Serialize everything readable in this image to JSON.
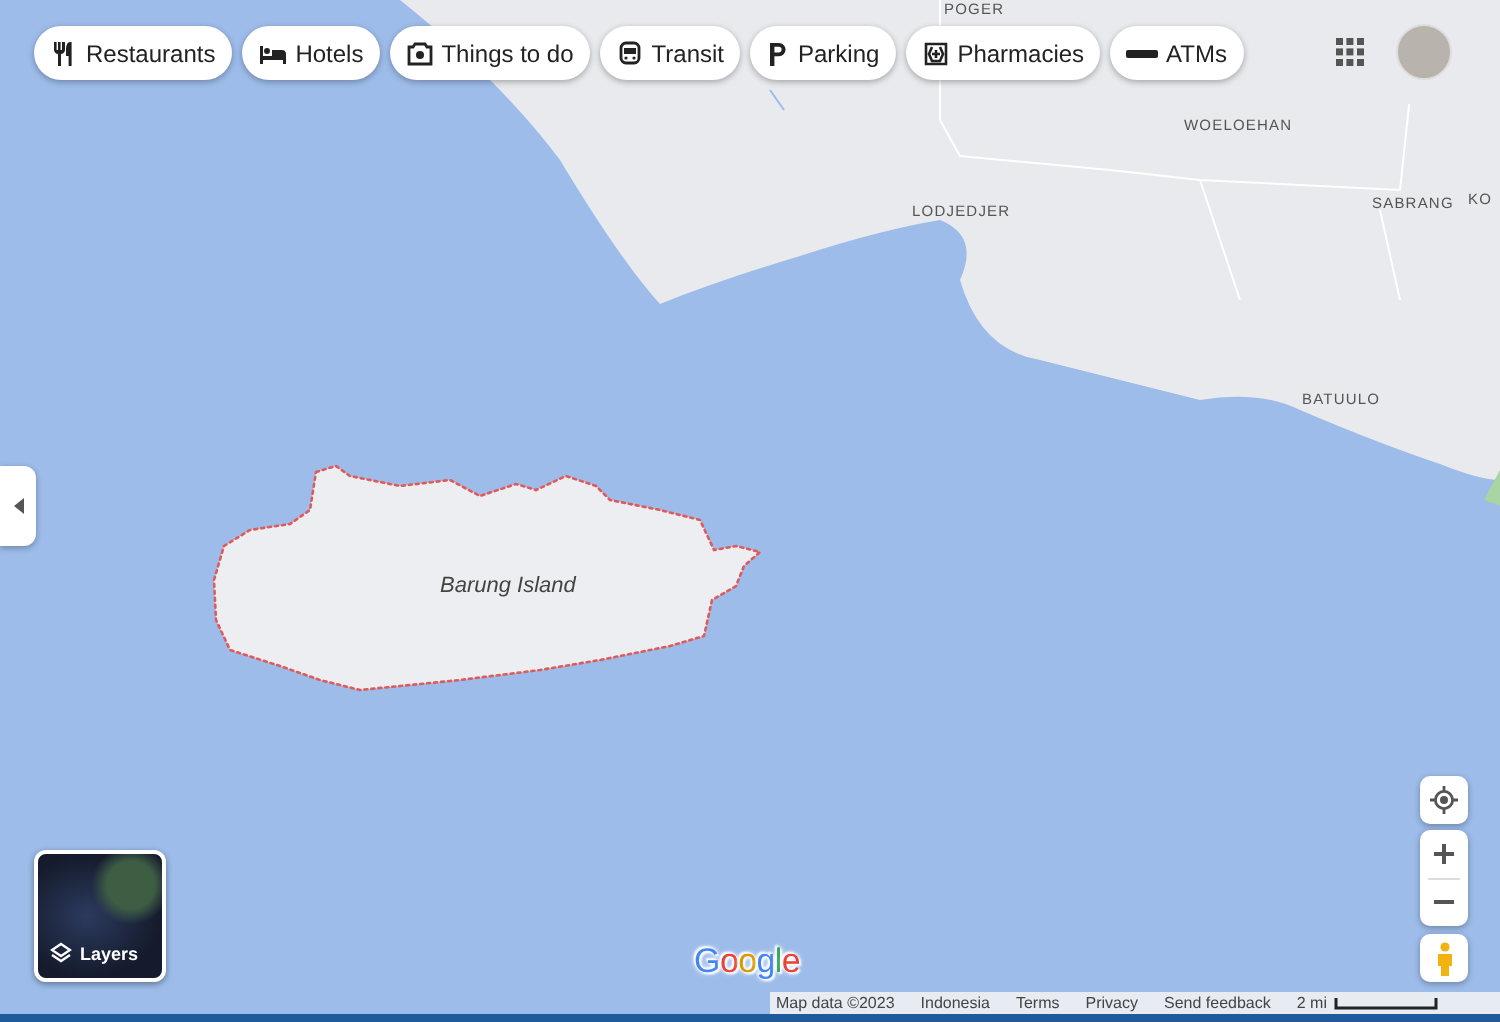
{
  "chips": [
    {
      "label": "Restaurants"
    },
    {
      "label": "Hotels"
    },
    {
      "label": "Things to do"
    },
    {
      "label": "Transit"
    },
    {
      "label": "Parking"
    },
    {
      "label": "Pharmacies"
    },
    {
      "label": "ATMs"
    }
  ],
  "map_labels": [
    {
      "text": "POGER",
      "kind": "village"
    },
    {
      "text": "WOELOEHAN",
      "kind": "village"
    },
    {
      "text": "LODJEDJER",
      "kind": "village"
    },
    {
      "text": "SABRANG",
      "kind": "village"
    },
    {
      "text": "KO",
      "kind": "village"
    },
    {
      "text": "BATUULO",
      "kind": "village"
    },
    {
      "text": "Barung Island",
      "kind": "island"
    }
  ],
  "layers": {
    "label": "Layers"
  },
  "logo": "Google",
  "attribution": {
    "items": [
      "Map data ©2023",
      "Indonesia",
      "Terms",
      "Privacy",
      "Send feedback"
    ],
    "scale": "2 mi"
  }
}
